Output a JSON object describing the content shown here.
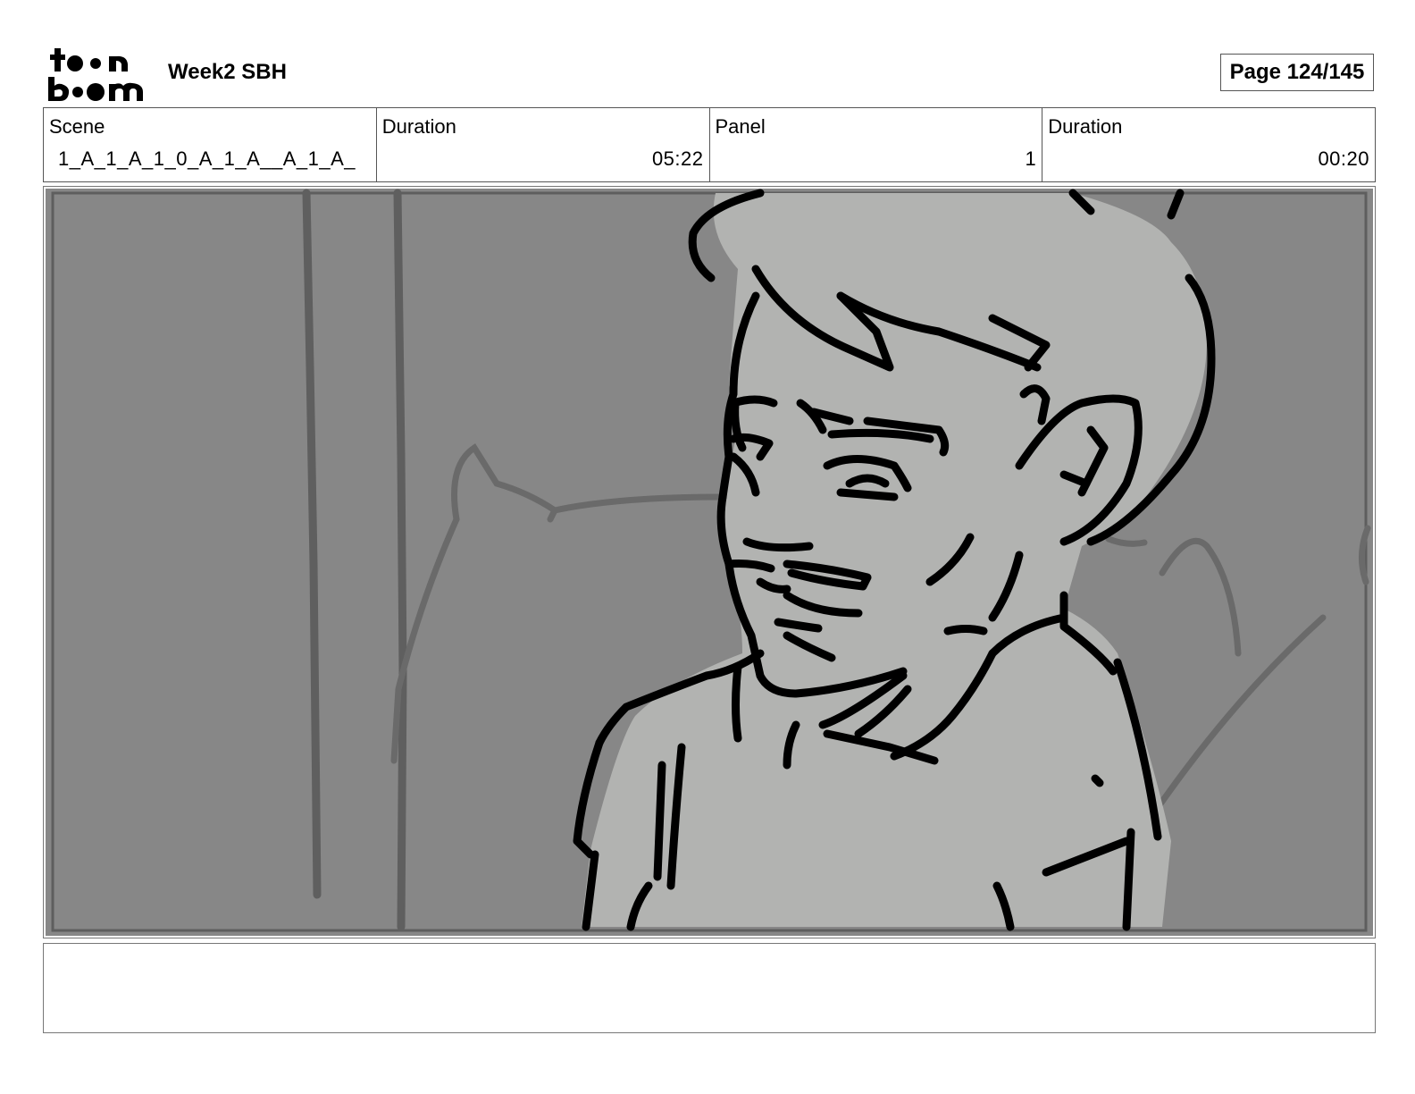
{
  "header": {
    "logo_text_top": "toon",
    "logo_text_bottom": "boom",
    "project_title": "Week2 SBH",
    "page_label": "Page 124/145"
  },
  "info_bar": {
    "scene_label": "Scene",
    "scene_value": "1_A_1_A_1_0_A_1_A__A_1_A_",
    "scene_duration_label": "Duration",
    "scene_duration_value": "05:22",
    "panel_label": "Panel",
    "panel_value": "1",
    "panel_duration_label": "Duration",
    "panel_duration_value": "00:20"
  },
  "panel": {
    "image_icon": "storyboard-sketch-man-with-mustache",
    "background_color": "#878787",
    "figure_color": "#b2b3b1",
    "line_color": "#000000"
  },
  "notes": {
    "text": ""
  }
}
